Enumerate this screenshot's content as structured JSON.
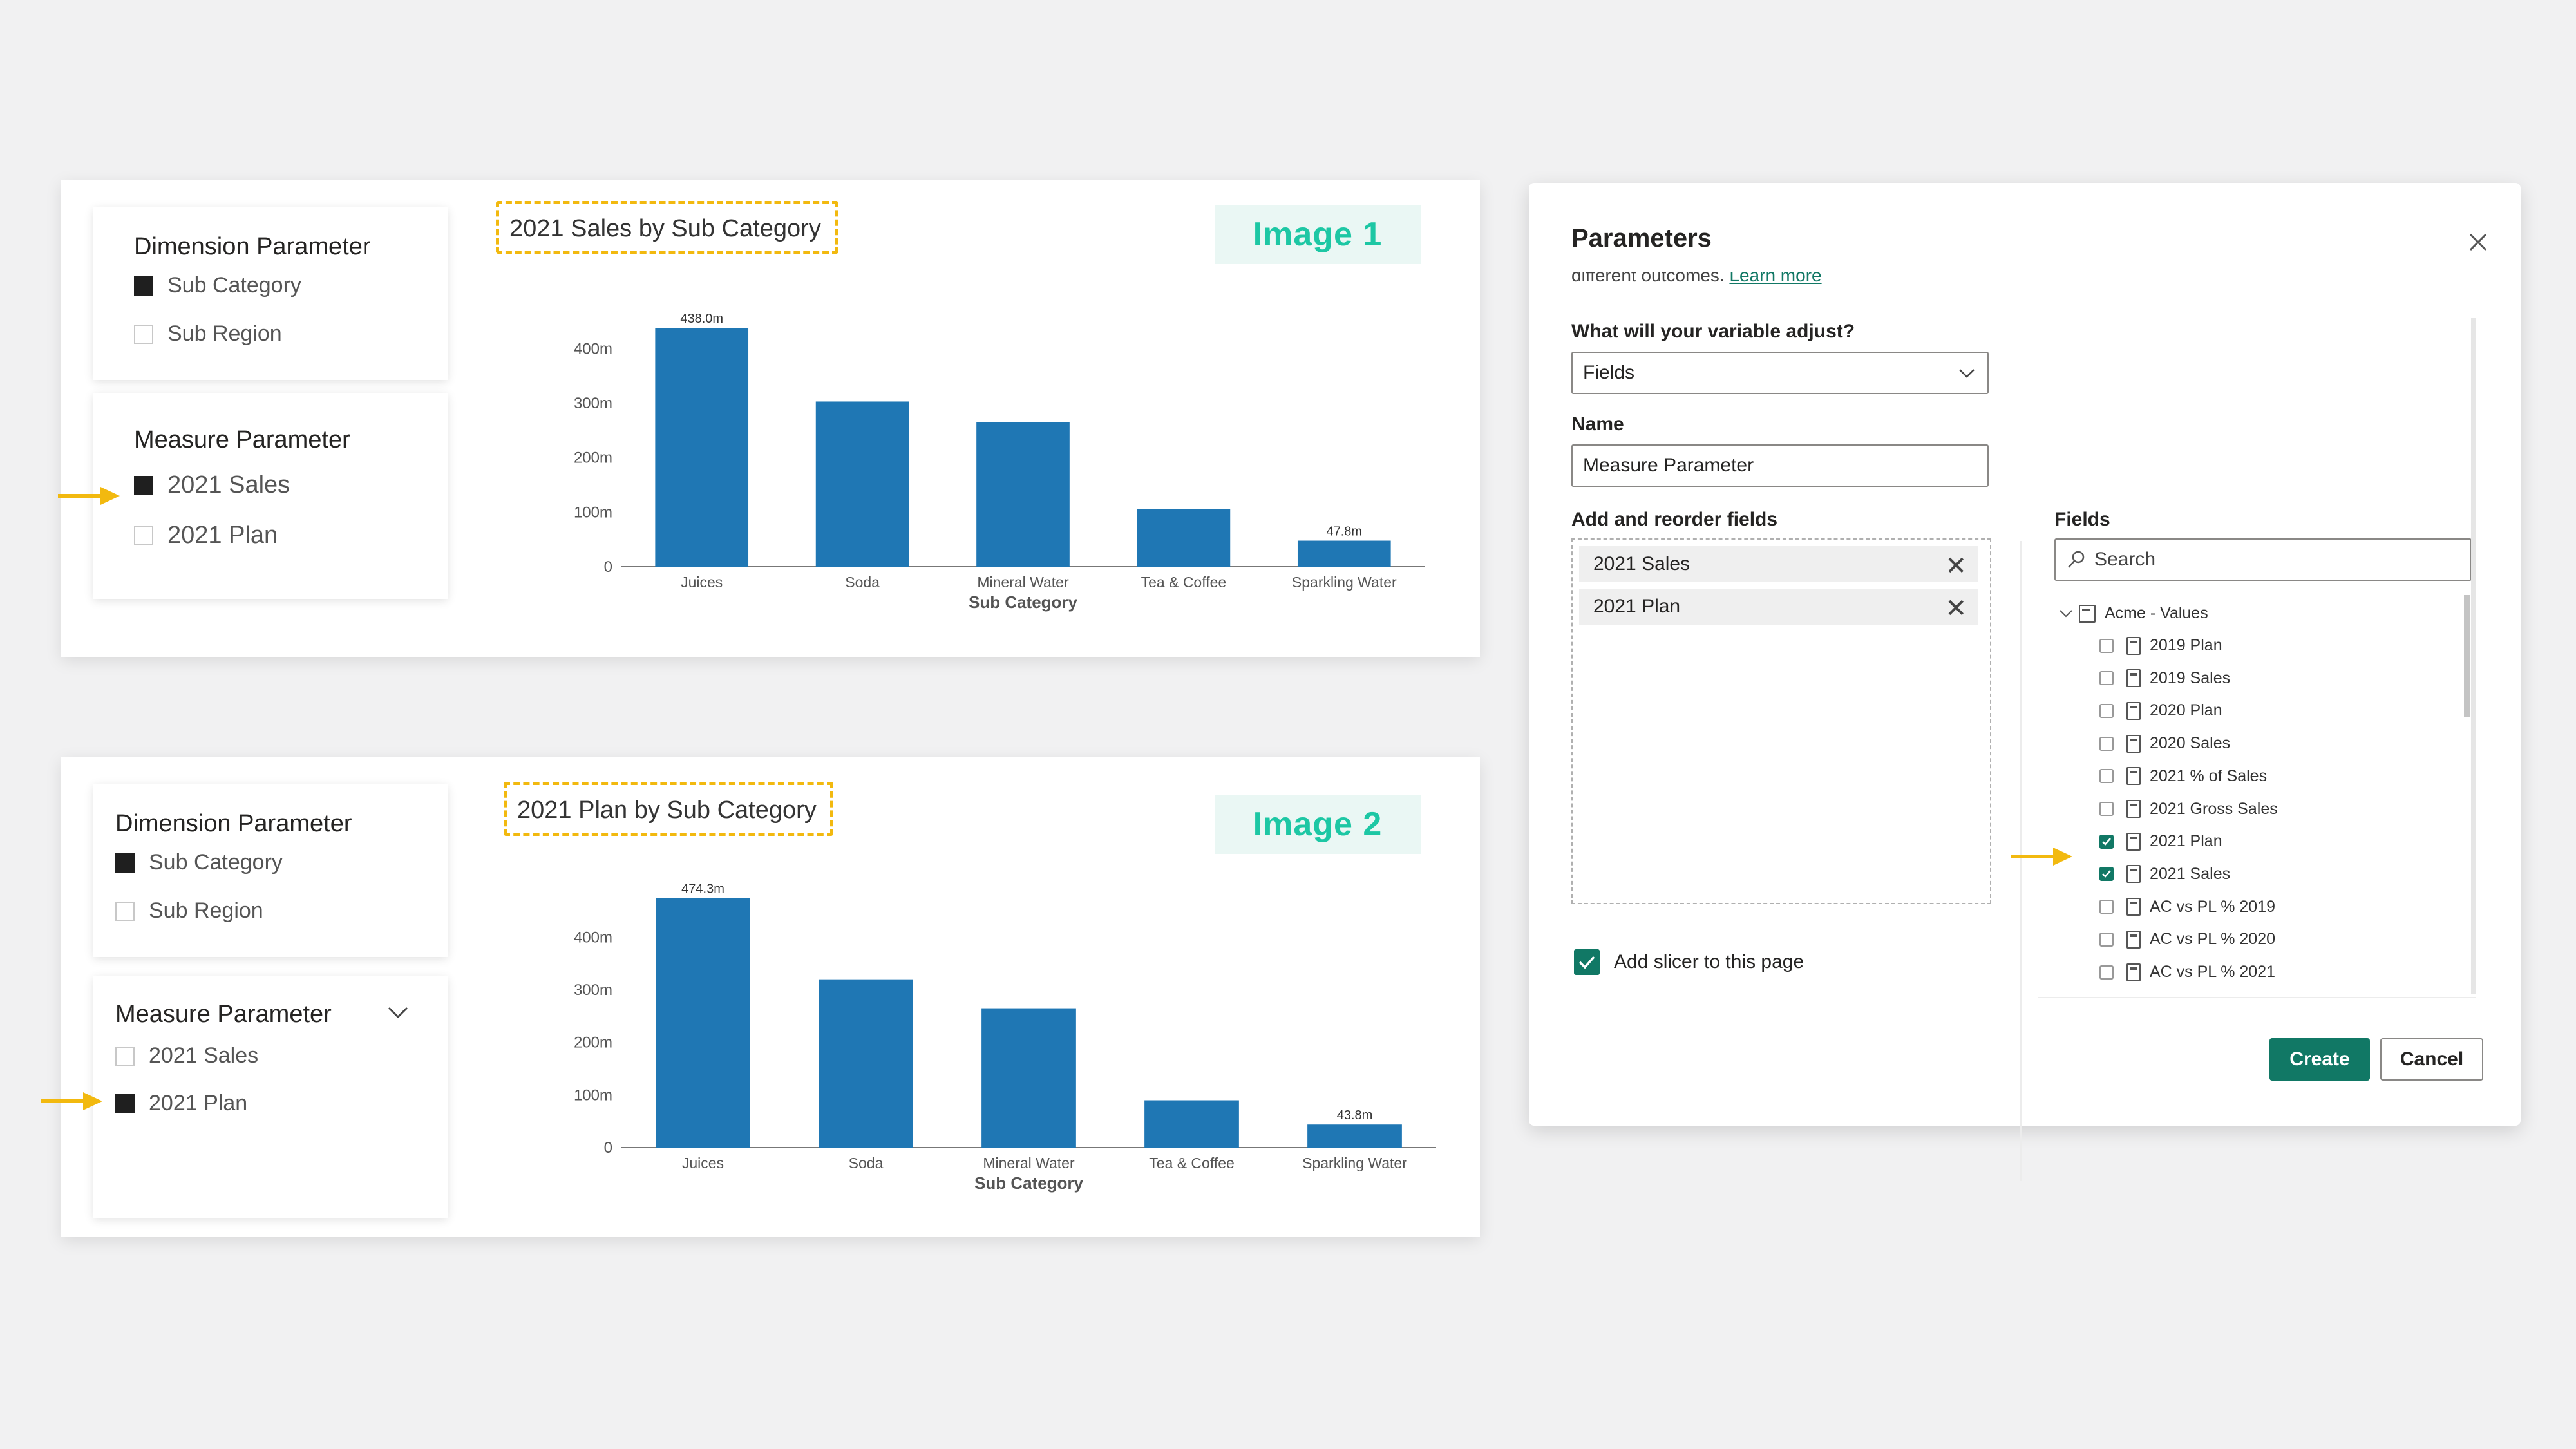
{
  "colors": {
    "bar": "#1f77b4",
    "accent_teal": "#117865",
    "highlight_dashed": "#f2b90f",
    "tag_text": "#1dc7a4",
    "arrow": "#f2b90f"
  },
  "panel1": {
    "dimension": {
      "title": "Dimension Parameter",
      "options": [
        "Sub Category",
        "Sub Region"
      ],
      "selected": [
        true,
        false
      ]
    },
    "measure": {
      "title": "Measure Parameter",
      "options": [
        "2021 Sales",
        "2021 Plan"
      ],
      "selected": [
        true,
        false
      ]
    },
    "chart_title": "2021 Sales by Sub Category",
    "tag": "Image 1"
  },
  "panel2": {
    "dimension": {
      "title": "Dimension Parameter",
      "options": [
        "Sub Category",
        "Sub Region"
      ],
      "selected": [
        true,
        false
      ]
    },
    "measure": {
      "title": "Measure Parameter",
      "options": [
        "2021 Sales",
        "2021 Plan"
      ],
      "selected": [
        false,
        true
      ]
    },
    "chart_title": "2021 Plan by Sub Category",
    "tag": "Image 2"
  },
  "chart_data": [
    {
      "type": "bar",
      "title": "2021 Sales by Sub Category",
      "categories": [
        "Juices",
        "Soda",
        "Mineral Water",
        "Tea & Coffee",
        "Sparkling Water"
      ],
      "values": [
        438.0,
        303,
        265,
        106,
        47.8
      ],
      "data_labels": [
        "438.0m",
        "",
        "",
        "",
        "47.8m"
      ],
      "xlabel": "Sub Category",
      "ylabel": "",
      "yticks": [
        "0",
        "100m",
        "200m",
        "300m",
        "400m"
      ],
      "ylim": [
        0,
        450
      ]
    },
    {
      "type": "bar",
      "title": "2021 Plan by Sub Category",
      "categories": [
        "Juices",
        "Soda",
        "Mineral Water",
        "Tea & Coffee",
        "Sparkling Water"
      ],
      "values": [
        474.3,
        320,
        265,
        90,
        43.8
      ],
      "data_labels": [
        "474.3m",
        "",
        "",
        "",
        "43.8m"
      ],
      "xlabel": "Sub Category",
      "ylabel": "",
      "yticks": [
        "0",
        "100m",
        "200m",
        "300m",
        "400m"
      ],
      "ylim": [
        0,
        480
      ]
    }
  ],
  "dialog": {
    "title": "Parameters",
    "close_icon": "close-icon",
    "cut_text": "different outcomes.",
    "learn_more": "Learn more",
    "adjust_label": "What will your variable adjust?",
    "adjust_value": "Fields",
    "name_label": "Name",
    "name_value": "Measure Parameter",
    "reorder_label": "Add and reorder fields",
    "selected_fields": [
      "2021 Sales",
      "2021 Plan"
    ],
    "fields_label": "Fields",
    "search_placeholder": "Search",
    "tree_root": "Acme - Values",
    "tree_items": [
      {
        "label": "2019 Plan",
        "checked": false
      },
      {
        "label": "2019 Sales",
        "checked": false
      },
      {
        "label": "2020 Plan",
        "checked": false
      },
      {
        "label": "2020 Sales",
        "checked": false
      },
      {
        "label": "2021 % of Sales",
        "checked": false
      },
      {
        "label": "2021 Gross Sales",
        "checked": false
      },
      {
        "label": "2021 Plan",
        "checked": true
      },
      {
        "label": "2021 Sales",
        "checked": true
      },
      {
        "label": "AC vs PL % 2019",
        "checked": false
      },
      {
        "label": "AC vs PL % 2020",
        "checked": false
      },
      {
        "label": "AC vs PL % 2021",
        "checked": false
      }
    ],
    "add_slicer_label": "Add slicer to this page",
    "add_slicer_checked": true,
    "create_label": "Create",
    "cancel_label": "Cancel"
  }
}
